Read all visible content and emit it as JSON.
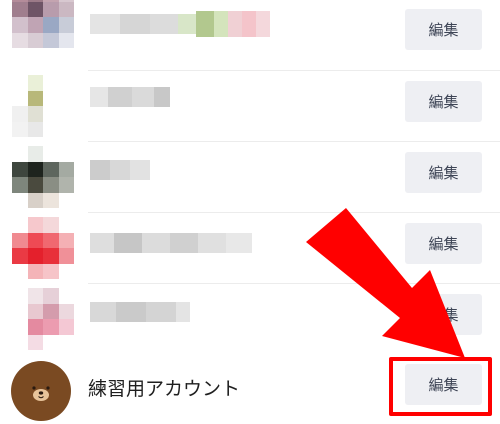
{
  "contacts": [
    {
      "edit_label": "編集",
      "avatar": "blurred-avatar",
      "name": "blurred-name"
    },
    {
      "edit_label": "編集",
      "avatar": "blurred-avatar",
      "name": "blurred-name"
    },
    {
      "edit_label": "編集",
      "avatar": "blurred-avatar",
      "name": "blurred-name"
    },
    {
      "edit_label": "編集",
      "avatar": "blurred-avatar",
      "name": "blurred-name"
    },
    {
      "edit_label": "編集",
      "avatar": "blurred-avatar",
      "name": "blurred-name"
    }
  ],
  "account": {
    "name": "練習用アカウント",
    "edit_label": "編集",
    "avatar_icon": "bear-face-icon"
  },
  "annotations": {
    "arrow_icon": "red-arrow-icon",
    "arrow_color": "#ff0000",
    "highlight_color": "#ff0000"
  }
}
